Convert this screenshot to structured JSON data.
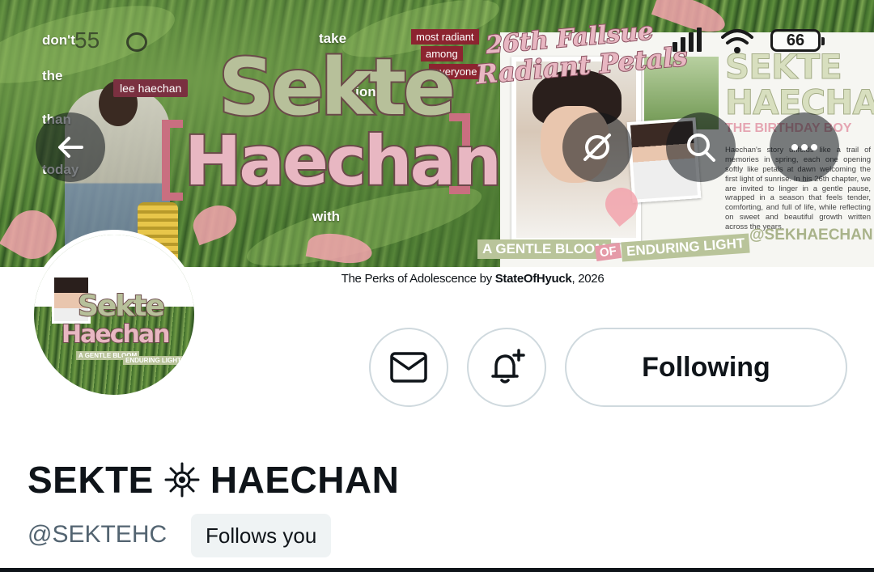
{
  "status_bar": {
    "time": "55",
    "battery": "66"
  },
  "banner": {
    "words_left": [
      "don't",
      "the",
      "than",
      "today"
    ],
    "words_mid": [
      "take",
      "motion",
      "with"
    ],
    "pills": [
      "most radiant",
      "among",
      "everyone"
    ],
    "name_tag": "lee haechan",
    "title_main": "Sekte",
    "title_sub": "Haechan",
    "script_line1": "26th Fallsue",
    "script_line2": "Radiant Petals",
    "poster_name1": "SEKTE",
    "poster_name2": "HAECHAN",
    "poster_subtitle": "THE BIRTHDAY BOY",
    "poster_story": "Haechan's story unfolds like a trail of memories in spring, each one opening softly like petals at dawn welcoming the first light of sunrise. In his 26th chapter, we are invited to linger in a gentle pause, wrapped in a season that feels tender, comforting, and full of life, while reflecting on sweet and beautiful growth written across the years.",
    "poster_handle": "@SEKHAECHAN",
    "tagline_a": "A GENTLE BLOOM",
    "tagline_of": "OF",
    "tagline_b": "ENDURING LIGHT",
    "caption_prefix": "The Perks of Adolescence by ",
    "caption_author": "StateOfHyuck",
    "caption_suffix": ", 2026"
  },
  "avatar": {
    "title_main": "Sekte",
    "title_sub": "Haechan",
    "tag_a": "A GENTLE BLOOM",
    "tag_b": "ENDURING LIGHT"
  },
  "actions": {
    "following_label": "Following"
  },
  "profile": {
    "name_part1": "SEKTE",
    "name_part2": "HAECHAN",
    "handle": "@SEKTEHC",
    "follows_you": "Follows you"
  },
  "colors": {
    "accent_green": "#b7c09a",
    "accent_pink": "#e8b7c2",
    "text_primary": "#0f1419",
    "text_secondary": "#536471",
    "border": "#cfd9de"
  }
}
